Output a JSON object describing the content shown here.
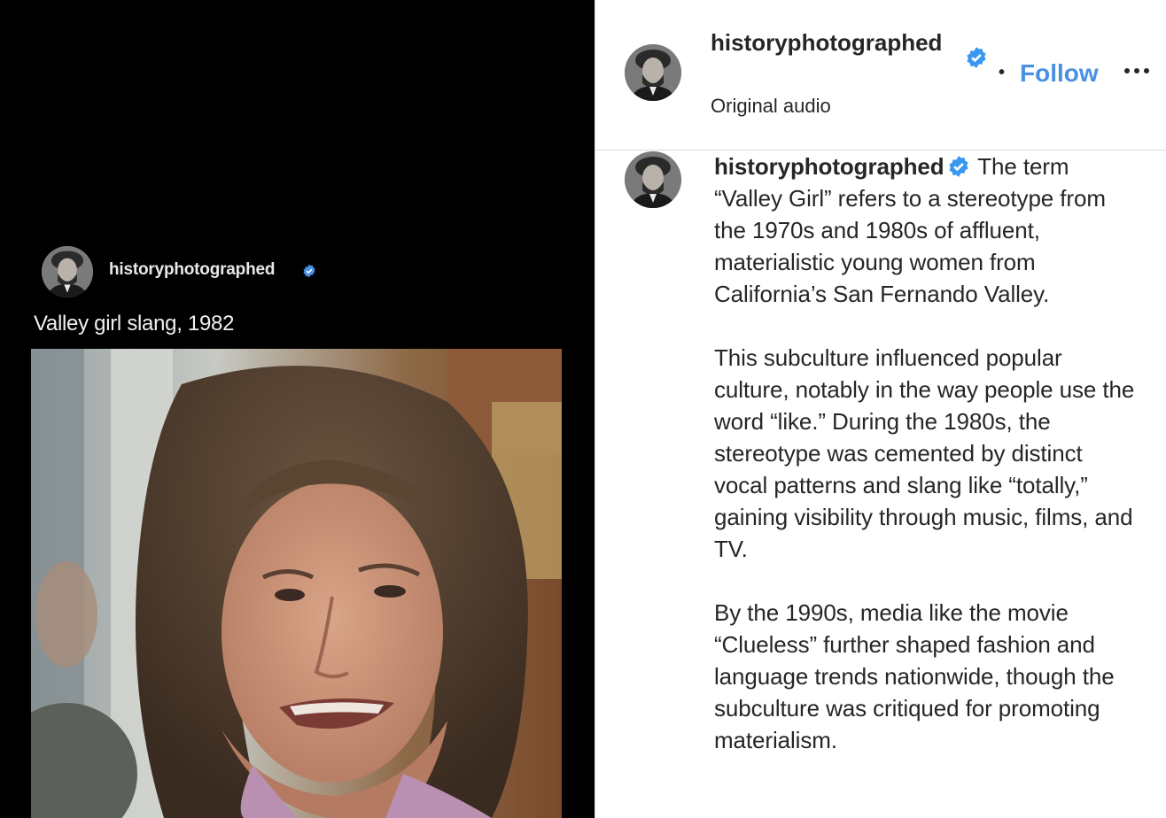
{
  "media": {
    "username": "historyphotographed",
    "caption": "Valley girl slang, 1982",
    "video_description": "1982 video still of a young woman with short brown feathered hair, talking and grimacing"
  },
  "header": {
    "username": "historyphotographed",
    "dot": "•",
    "follow_label": "Follow",
    "audio_label": "Original audio",
    "more_icon": "more-horizontal-icon"
  },
  "comment": {
    "username": "historyphotographed",
    "paragraphs": [
      "The term “Valley Girl” refers to a stereotype from the 1970s and 1980s of affluent, materialistic young women from California’s San Fernando Valley.",
      "This subculture influenced popular culture, notably in the way people use the word “like.” During the 1980s, the stereotype was cemented by distinct vocal patterns and slang like “totally,” gaining visibility through music, films, and TV.",
      "By the 1990s, media like the movie “Clueless” further shaped fashion and language trends nationwide, though the subculture was critiqued for promoting materialism."
    ]
  },
  "colors": {
    "accent": "#4a90e2",
    "verified": "#3897f0",
    "text": "#262626",
    "divider": "#dbdbdb"
  }
}
